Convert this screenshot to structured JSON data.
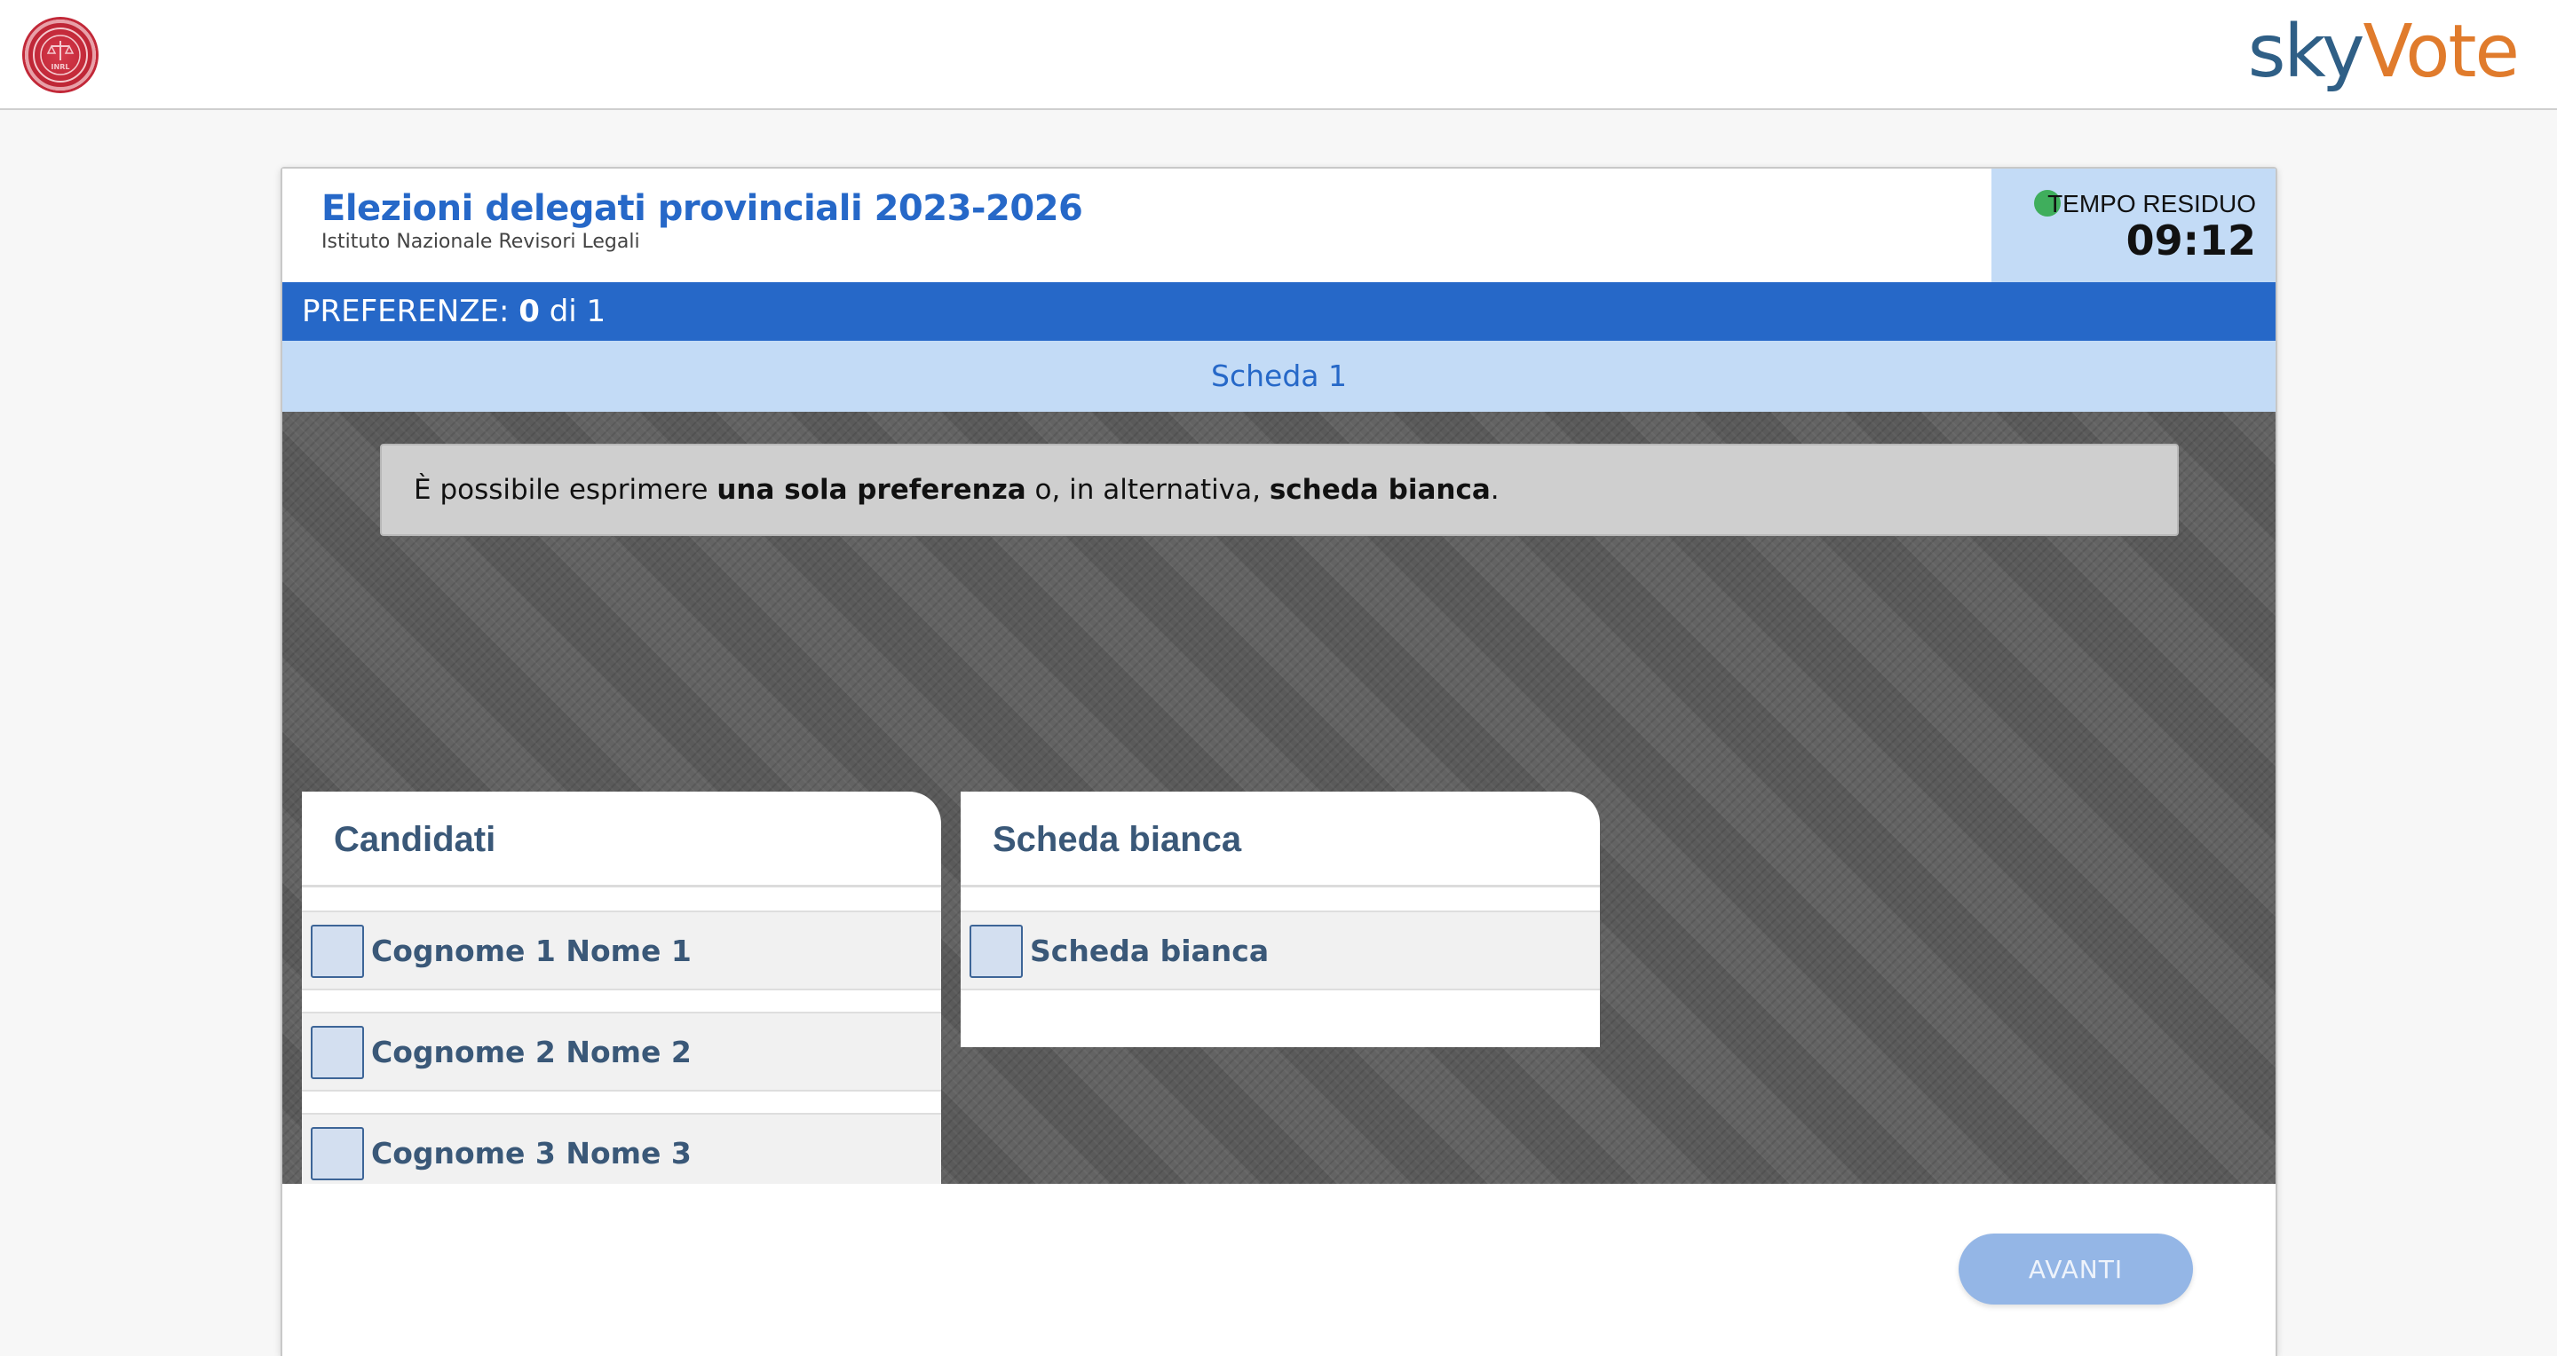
{
  "brand": {
    "logo_sky": "sky",
    "logo_vote": "Vote",
    "seal_text": "INRL"
  },
  "header": {
    "title": "Elezioni delegati provinciali 2023-2026",
    "subtitle": "Istituto Nazionale Revisori Legali",
    "timer_label": "TEMPO RESIDUO",
    "timer_value": "09:12",
    "timer_status_color": "#3fae5c"
  },
  "preferences": {
    "label": "PREFERENZE:",
    "count": "0",
    "of_total": "di 1"
  },
  "ballot": {
    "name": "Scheda 1",
    "notice": {
      "part1": "È possibile esprimere ",
      "bold1": "una sola preferenza",
      "part2": " o, in alternativa, ",
      "bold2": "scheda bianca",
      "part3": "."
    }
  },
  "candidates_panel": {
    "title": "Candidati",
    "items": [
      {
        "label": "Cognome 1 Nome 1",
        "checked": false
      },
      {
        "label": "Cognome 2 Nome 2",
        "checked": false
      },
      {
        "label": "Cognome 3 Nome 3",
        "checked": false
      }
    ]
  },
  "blank_panel": {
    "title": "Scheda bianca",
    "items": [
      {
        "label": "Scheda bianca",
        "checked": false
      }
    ]
  },
  "footer": {
    "next_label": "AVANTI"
  },
  "colors": {
    "primary": "#2668c8",
    "light_blue": "#c3dbf6",
    "label_blue": "#3a5878",
    "button_disabled": "#94b6e6",
    "seal_red": "#c22838",
    "logo_blue": "#2f5f86",
    "logo_orange": "#e07b2c"
  }
}
